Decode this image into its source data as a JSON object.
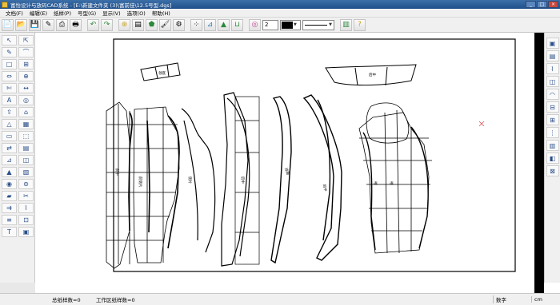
{
  "window": {
    "title": "富怡设计与放码CAD系统 - [E:\\新建文件夹 (3)\\富前佳\\12.5号型.dgs]",
    "buttons": [
      "_",
      "□",
      "×"
    ]
  },
  "menu": [
    "文档(F)",
    "编辑(E)",
    "纸样(P)",
    "号型(G)",
    "显示(V)",
    "选项(O)",
    "帮助(H)"
  ],
  "toolbar": {
    "buttons": [
      "新建",
      "打开",
      "保存",
      "读纸样",
      "导入",
      "打印",
      "撤销",
      "重做",
      "号型",
      "纸样",
      "款式",
      "颜色",
      "定位",
      "点",
      "折线",
      "线",
      "显示",
      "色彩",
      "标识"
    ],
    "number_value": "2",
    "color_value": "#000000"
  },
  "lefttools": {
    "icons": [
      "↖",
      "⇱",
      "✎",
      "⌒",
      "□",
      "⊞",
      "⇔",
      "⊕",
      "✄",
      "↔",
      "A",
      "◎",
      "⇪",
      "⌂",
      "△",
      "▦",
      "▭",
      "⬚",
      "⇄",
      "▤",
      "⊿",
      "◫",
      "▲",
      "▧",
      "◉",
      "⊜",
      "▰",
      "✂",
      "⇉",
      "⌇",
      "≡",
      "⊡",
      "T",
      "▣"
    ]
  },
  "righttools": {
    "icons": [
      "▣",
      "▤",
      "⌇",
      "◫",
      "◠",
      "⊟",
      "⊞",
      "⋮",
      "▥",
      "◧",
      "⊠"
    ]
  },
  "status": {
    "total_pieces": "总纸样数=0",
    "workspace_pieces": "工作区纸样数=0",
    "mode": "数字",
    "unit": "cm"
  },
  "canvas": {
    "labels": [
      "前中",
      "前侧片",
      "侧片",
      "后中",
      "挂面",
      "领底",
      "后中",
      "后中",
      "袖",
      "袖"
    ]
  }
}
